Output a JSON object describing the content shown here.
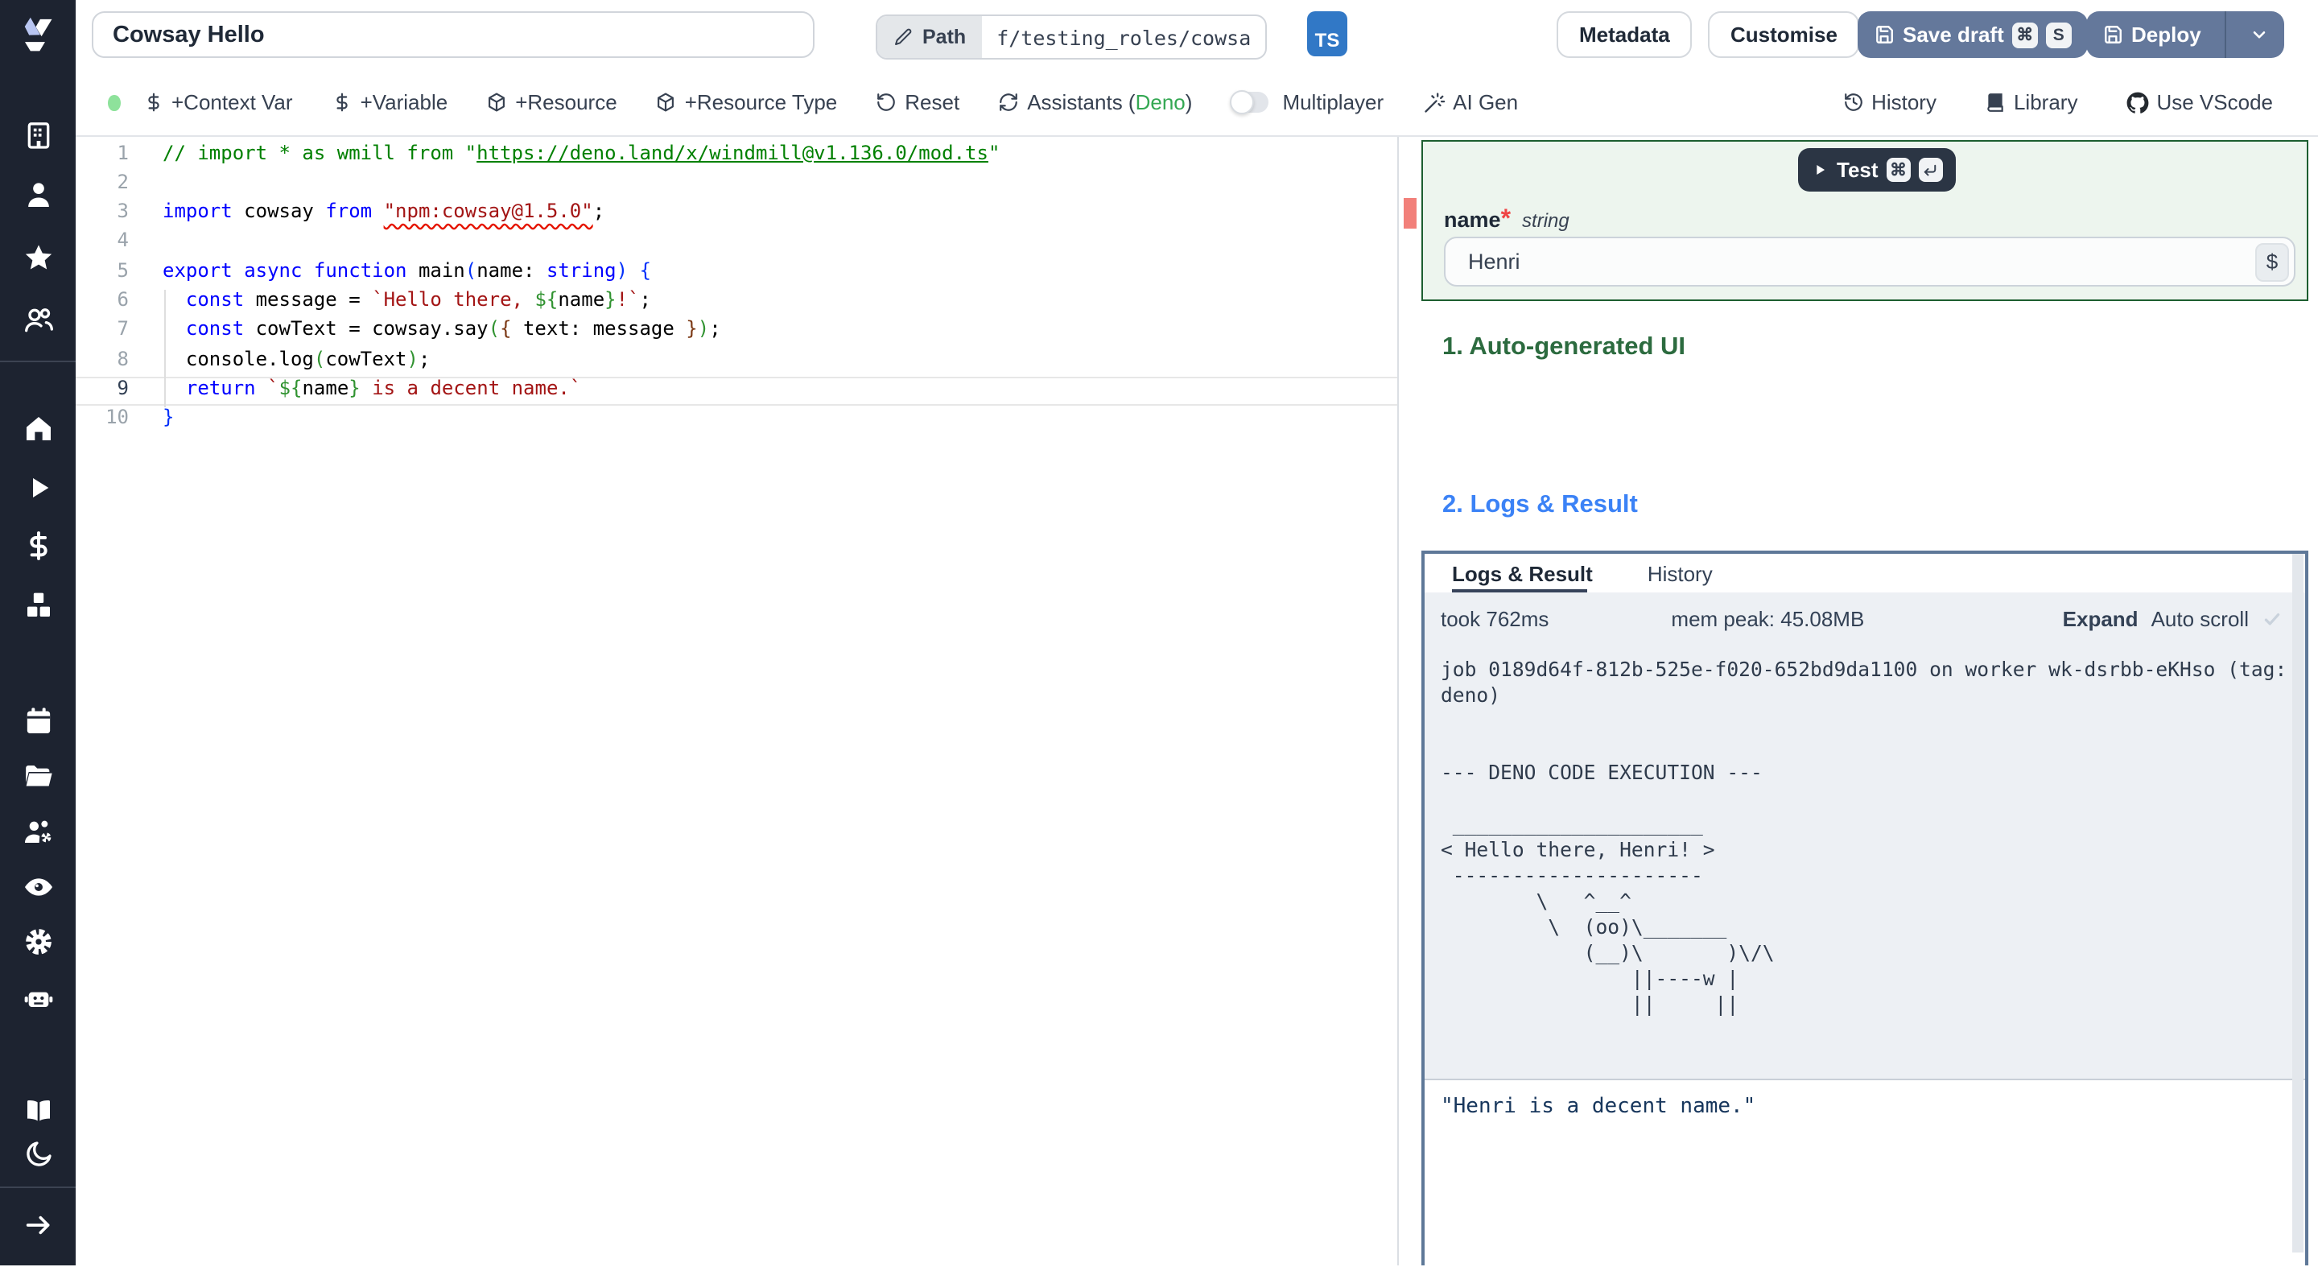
{
  "topbar": {
    "script_name": "Cowsay Hello",
    "path_label": "Path",
    "path_value": "f/testing_roles/cowsa",
    "lang_badge": "TS",
    "metadata_label": "Metadata",
    "customise_label": "Customise",
    "save_draft_label": "Save draft",
    "save_shortcut_mod": "⌘",
    "save_shortcut_key": "S",
    "deploy_label": "Deploy"
  },
  "toolbar": {
    "context_var": "+Context Var",
    "variable": "+Variable",
    "resource": "+Resource",
    "resource_type": "+Resource Type",
    "reset": "Reset",
    "assistants_prefix": "Assistants (",
    "assistants_lang": "Deno",
    "assistants_suffix": ")",
    "multiplayer": "Multiplayer",
    "ai_gen": "AI Gen",
    "history": "History",
    "library": "Library",
    "use_vscode": "Use VScode"
  },
  "sidebar": {
    "top": [
      "building",
      "user",
      "star",
      "users"
    ],
    "main": [
      "home",
      "play",
      "dollar",
      "boxes"
    ],
    "manage": [
      "calendar",
      "folder-open",
      "user-cog",
      "eye",
      "gear",
      "bot"
    ],
    "bottom": [
      "book-open",
      "moon"
    ],
    "foot": [
      "arrow-right"
    ]
  },
  "editor": {
    "lines": [
      {
        "n": 1,
        "tokens": [
          {
            "c": "com",
            "t": "// import * as wmill from \""
          },
          {
            "c": "com link",
            "t": "https://deno.land/x/windmill@v1.136.0/mod.ts"
          },
          {
            "c": "com",
            "t": "\""
          }
        ]
      },
      {
        "n": 2,
        "tokens": []
      },
      {
        "n": 3,
        "tokens": [
          {
            "c": "kw",
            "t": "import"
          },
          {
            "c": "pl",
            "t": " cowsay "
          },
          {
            "c": "kw",
            "t": "from"
          },
          {
            "c": "pl",
            "t": " "
          },
          {
            "c": "str err",
            "t": "\"npm:cowsay@1.5.0\""
          },
          {
            "c": "pl",
            "t": ";"
          }
        ]
      },
      {
        "n": 4,
        "tokens": []
      },
      {
        "n": 5,
        "tokens": [
          {
            "c": "kw",
            "t": "export"
          },
          {
            "c": "pl",
            "t": " "
          },
          {
            "c": "kw",
            "t": "async"
          },
          {
            "c": "pl",
            "t": " "
          },
          {
            "c": "kw",
            "t": "function"
          },
          {
            "c": "pl",
            "t": " main"
          },
          {
            "c": "br1",
            "t": "("
          },
          {
            "c": "pl",
            "t": "name: "
          },
          {
            "c": "kw",
            "t": "string"
          },
          {
            "c": "br1",
            "t": ")"
          },
          {
            "c": "pl",
            "t": " "
          },
          {
            "c": "br1",
            "t": "{"
          }
        ]
      },
      {
        "n": 6,
        "tokens": [
          {
            "c": "pl",
            "t": "  "
          },
          {
            "c": "kw",
            "t": "const"
          },
          {
            "c": "pl",
            "t": " message = "
          },
          {
            "c": "str",
            "t": "`Hello there, "
          },
          {
            "c": "br2",
            "t": "${"
          },
          {
            "c": "pl",
            "t": "name"
          },
          {
            "c": "br2",
            "t": "}"
          },
          {
            "c": "str",
            "t": "!`"
          },
          {
            "c": "pl",
            "t": ";"
          }
        ]
      },
      {
        "n": 7,
        "tokens": [
          {
            "c": "pl",
            "t": "  "
          },
          {
            "c": "kw",
            "t": "const"
          },
          {
            "c": "pl",
            "t": " cowText = cowsay.say"
          },
          {
            "c": "br2",
            "t": "("
          },
          {
            "c": "br3",
            "t": "{"
          },
          {
            "c": "pl",
            "t": " text: message "
          },
          {
            "c": "br3",
            "t": "}"
          },
          {
            "c": "br2",
            "t": ")"
          },
          {
            "c": "pl",
            "t": ";"
          }
        ]
      },
      {
        "n": 8,
        "tokens": [
          {
            "c": "pl",
            "t": "  console.log"
          },
          {
            "c": "br2",
            "t": "("
          },
          {
            "c": "pl",
            "t": "cowText"
          },
          {
            "c": "br2",
            "t": ")"
          },
          {
            "c": "pl",
            "t": ";"
          }
        ]
      },
      {
        "n": 9,
        "cur": true,
        "tokens": [
          {
            "c": "pl",
            "t": "  "
          },
          {
            "c": "kw",
            "t": "return"
          },
          {
            "c": "pl",
            "t": " "
          },
          {
            "c": "str",
            "t": "`"
          },
          {
            "c": "br2",
            "t": "${"
          },
          {
            "c": "pl",
            "t": "name"
          },
          {
            "c": "br2",
            "t": "}"
          },
          {
            "c": "str",
            "t": " is a decent name.`"
          }
        ]
      },
      {
        "n": 10,
        "tokens": [
          {
            "c": "br1",
            "t": "}"
          }
        ]
      }
    ]
  },
  "form": {
    "test_label": "Test",
    "test_shortcut_mod": "⌘",
    "name_label": "name",
    "required_mark": "*",
    "type_label": "string",
    "value": "Henri",
    "var_picker_label": "$"
  },
  "sections": {
    "auto_ui": "1. Auto-generated UI",
    "logs_result": "2. Logs & Result"
  },
  "logs": {
    "tab_active": "Logs & Result",
    "tab_history": "History",
    "took": "took 762ms",
    "mem": "mem peak: 45.08MB",
    "expand": "Expand",
    "autoscroll": "Auto scroll",
    "log_text": "job 0189d64f-812b-525e-f020-652bd9da1100 on worker wk-dsrbb-eKHso (tag:\ndeno)\n\n\n--- DENO CODE EXECUTION ---\n\n _____________________\n< Hello there, Henri! >\n ---------------------\n        \\   ^__^\n         \\  (oo)\\_______\n            (__)\\       )\\/\\\n                ||----w |\n                ||     ||",
    "result": "\"Henri is a decent name.\""
  },
  "colors": {
    "sidebar_bg": "#1d2330",
    "ts_badge": "#3178c6",
    "primary_button": "#64789b",
    "panel_green_border": "#1d5e30",
    "section_green": "#2c6b3f",
    "section_blue": "#3b82f6",
    "logs_border": "#5e7898",
    "error_red": "#e51400",
    "status_dot": "#8ee29b"
  }
}
